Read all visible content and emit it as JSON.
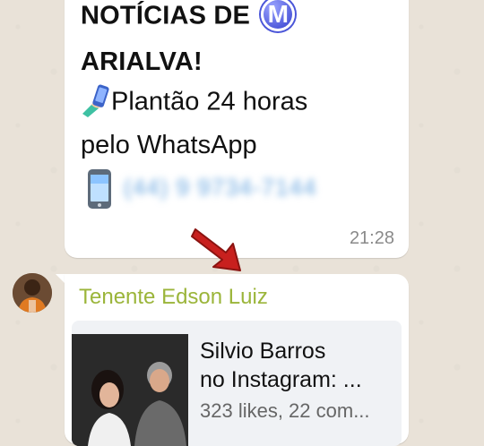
{
  "message1": {
    "title_line1": "NOTÍCIAS DE",
    "badge_letter": "M",
    "title_line2": "ARIALVA!",
    "line1": "Plantão 24 horas",
    "line2": "pelo WhatsApp",
    "phone_blurred": "(44) 9 9734-7144",
    "time": "21:28"
  },
  "message2": {
    "sender": "Tenente Edson Luiz",
    "preview_title_1": "Silvio Barros",
    "preview_title_2": "no Instagram: ...",
    "preview_meta": "323 likes, 22 com..."
  },
  "colors": {
    "background": "#e9e2d8",
    "bubble": "#ffffff",
    "sender_name": "#9bb53a",
    "arrow": "#c8201e",
    "badge": "#4a55d8"
  },
  "icons": [
    "hand-phone-icon",
    "mobile-phone-icon",
    "red-arrow-icon",
    "badge-m-icon"
  ]
}
